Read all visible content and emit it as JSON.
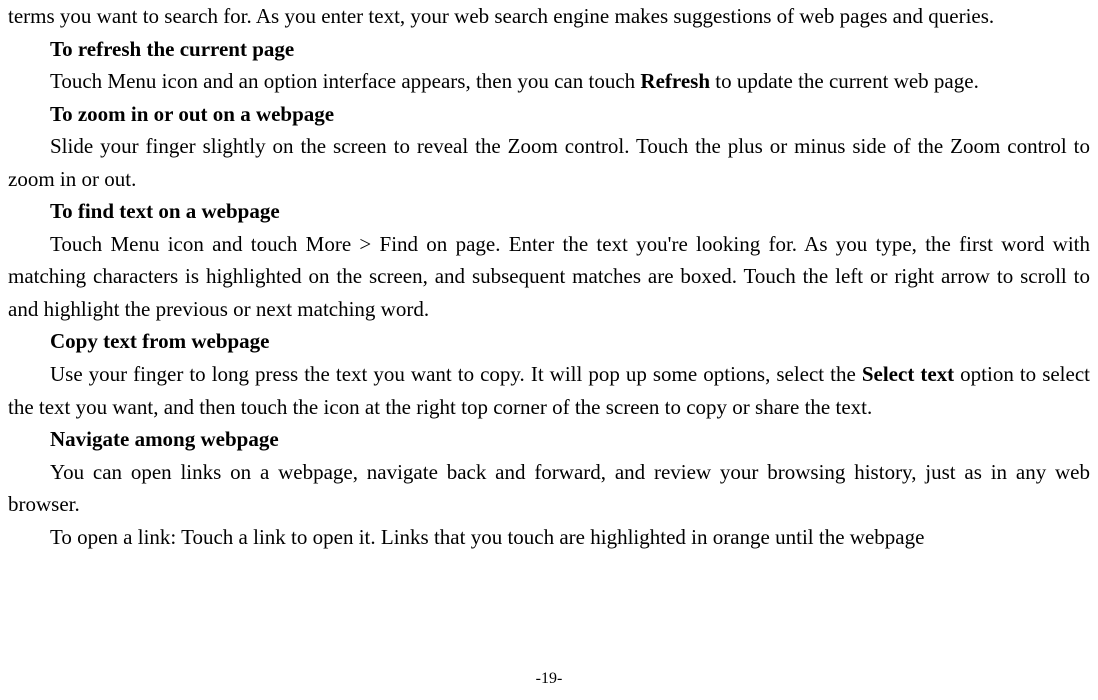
{
  "doc": {
    "p1": "terms you want to search for. As you enter text, your web search engine makes suggestions of web pages and queries.",
    "h1": "To refresh the current page",
    "p2a": "Touch Menu icon and an option interface appears, then you can touch ",
    "p2b": "Refresh",
    "p2c": " to update the current web page.",
    "h2": "To zoom in or out on a webpage",
    "p3": "Slide your finger slightly on the screen to reveal the Zoom control. Touch the plus or minus side of the Zoom control to zoom in or out.",
    "h3": "To find text on a webpage",
    "p4": "Touch Menu icon and touch More > Find on page. Enter the text you're looking for. As you type, the first word with matching characters is highlighted on the screen, and subsequent matches are boxed. Touch the left or right arrow to scroll to and highlight the previous or next matching word.",
    "h4": "Copy text from webpage",
    "p5a": "Use your finger to long press the text you want to copy. It will pop up some options, select the ",
    "p5b": "Select text",
    "p5c": " option to select the text you want, and then touch the icon at the right top corner of the screen to copy or share the text.",
    "h5": "Navigate among webpage",
    "p6": "You can open links on a webpage, navigate back and forward, and review your browsing history, just as in any web browser.",
    "p7": "To open a link: Touch a link to open it. Links that you touch are highlighted in orange until the webpage",
    "pagenum": "-19-"
  }
}
